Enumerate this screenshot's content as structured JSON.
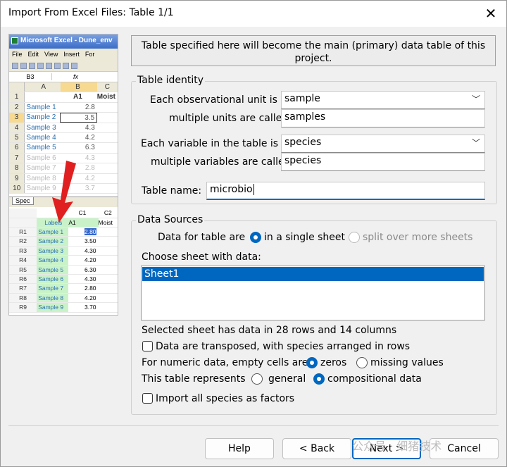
{
  "window": {
    "title": "Import From Excel Files: Table 1/1",
    "close_icon": "close-icon"
  },
  "preview": {
    "app_title": "Microsoft Excel - Dune_env",
    "menu": [
      "File",
      "Edit",
      "View",
      "Insert",
      "For"
    ],
    "cell_ref": "B3",
    "fx": "fx",
    "col_headers": [
      "A",
      "B",
      "C"
    ],
    "row_header_label": "A1",
    "moist_header": "Moist",
    "rows": [
      {
        "n": "2",
        "label": "Sample 1",
        "value": "2.8"
      },
      {
        "n": "3",
        "label": "Sample 2",
        "value": "3.5"
      },
      {
        "n": "4",
        "label": "Sample 3",
        "value": "4.3"
      },
      {
        "n": "5",
        "label": "Sample 4",
        "value": "4.2"
      },
      {
        "n": "6",
        "label": "Sample 5",
        "value": "6.3"
      },
      {
        "n": "7",
        "label": "Sample 6",
        "value": "4.3"
      },
      {
        "n": "8",
        "label": "Sample 7",
        "value": "2.8"
      },
      {
        "n": "9",
        "label": "Sample 8",
        "value": "4.2"
      },
      {
        "n": "10",
        "label": "Sample 9",
        "value": "3.7"
      }
    ],
    "tab": "Spec",
    "spec_headers": [
      "Labels",
      "A1",
      "Moist"
    ],
    "spec_c1": "C1",
    "spec_c2": "C2",
    "spec_rows": [
      {
        "r": "R1",
        "label": "Sample 1",
        "value": "2.80"
      },
      {
        "r": "R2",
        "label": "Sample 2",
        "value": "3.50"
      },
      {
        "r": "R3",
        "label": "Sample 3",
        "value": "4.30"
      },
      {
        "r": "R4",
        "label": "Sample 4",
        "value": "4.20"
      },
      {
        "r": "R5",
        "label": "Sample 5",
        "value": "6.30"
      },
      {
        "r": "R6",
        "label": "Sample 6",
        "value": "4.30"
      },
      {
        "r": "R7",
        "label": "Sample 7",
        "value": "2.80"
      },
      {
        "r": "R8",
        "label": "Sample 8",
        "value": "4.20"
      },
      {
        "r": "R9",
        "label": "Sample 9",
        "value": "3.70"
      }
    ]
  },
  "banner": "Table specified here will become the main (primary) data table of this project.",
  "identity": {
    "title": "Table identity",
    "unit_label": "Each observational unit is a",
    "unit_value": "sample",
    "units_called_label": "multiple units are called",
    "units_called_value": "samples",
    "variable_label": "Each variable in the table is a",
    "variable_value": "species",
    "variables_called_label": "multiple variables are called",
    "variables_called_value": "species",
    "table_name_label": "Table name:",
    "table_name_value": "microbio"
  },
  "sources": {
    "title": "Data Sources",
    "data_for_label": "Data for table are",
    "single_sheet": "in a single sheet",
    "split_sheets": "split over more sheets",
    "choose_label": "Choose sheet with data:",
    "sheets": [
      "Sheet1"
    ],
    "summary": "Selected sheet has data in 28 rows and 14 columns",
    "transposed": "Data are transposed, with species arranged in rows",
    "numeric_label": "For numeric data, empty cells are",
    "zeros": "zeros",
    "missing": "missing values",
    "represents_label": "This table represents",
    "general": "general",
    "compositional": "compositional data",
    "factors": "Import all species as factors"
  },
  "buttons": {
    "help": "Help",
    "back": "< Back",
    "next": "Next >",
    "cancel": "Cancel"
  },
  "watermark": "公众号 · 细猪技术",
  "colors": {
    "accent": "#0067c0",
    "arrow": "#e02020"
  }
}
